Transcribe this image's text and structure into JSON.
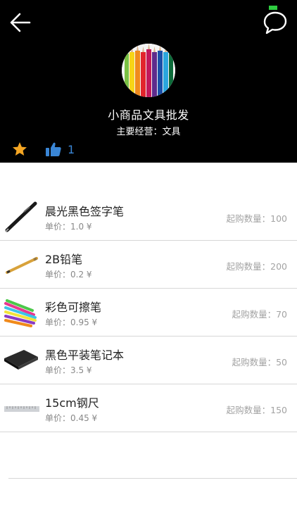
{
  "shop": {
    "name": "小商品文具批发",
    "business_label": "主要经营：",
    "business_value": "文具",
    "likes": "1"
  },
  "colors": {
    "header_bg": "#000000",
    "accent_like": "#3a86d6",
    "star": "#f5a623",
    "chat_badge": "#2ecc40"
  },
  "icons": {
    "back": "arrow-left-icon",
    "chat": "chat-bubble-icon",
    "favorite": "star-icon",
    "like": "thumbs-up-icon"
  },
  "products": [
    {
      "name": "晨光黑色签字笔",
      "price_label": "单价：",
      "price": "1.0 ¥",
      "qty_label": "起购数量：",
      "qty": "100",
      "thumb": "black-pen-image"
    },
    {
      "name": "2B铅笔",
      "price_label": "单价：",
      "price": "0.2 ¥",
      "qty_label": "起购数量：",
      "qty": "200",
      "thumb": "pencil-image"
    },
    {
      "name": "彩色可擦笔",
      "price_label": "单价：",
      "price": "0.95 ¥",
      "qty_label": "起购数量：",
      "qty": "70",
      "thumb": "color-pens-image"
    },
    {
      "name": "黑色平装笔记本",
      "price_label": "单价：",
      "price": "3.5 ¥",
      "qty_label": "起购数量：",
      "qty": "50",
      "thumb": "notebook-image"
    },
    {
      "name": "15cm钢尺",
      "price_label": "单价：",
      "price": "0.45 ¥",
      "qty_label": "起购数量：",
      "qty": "150",
      "thumb": "steel-ruler-image"
    }
  ]
}
